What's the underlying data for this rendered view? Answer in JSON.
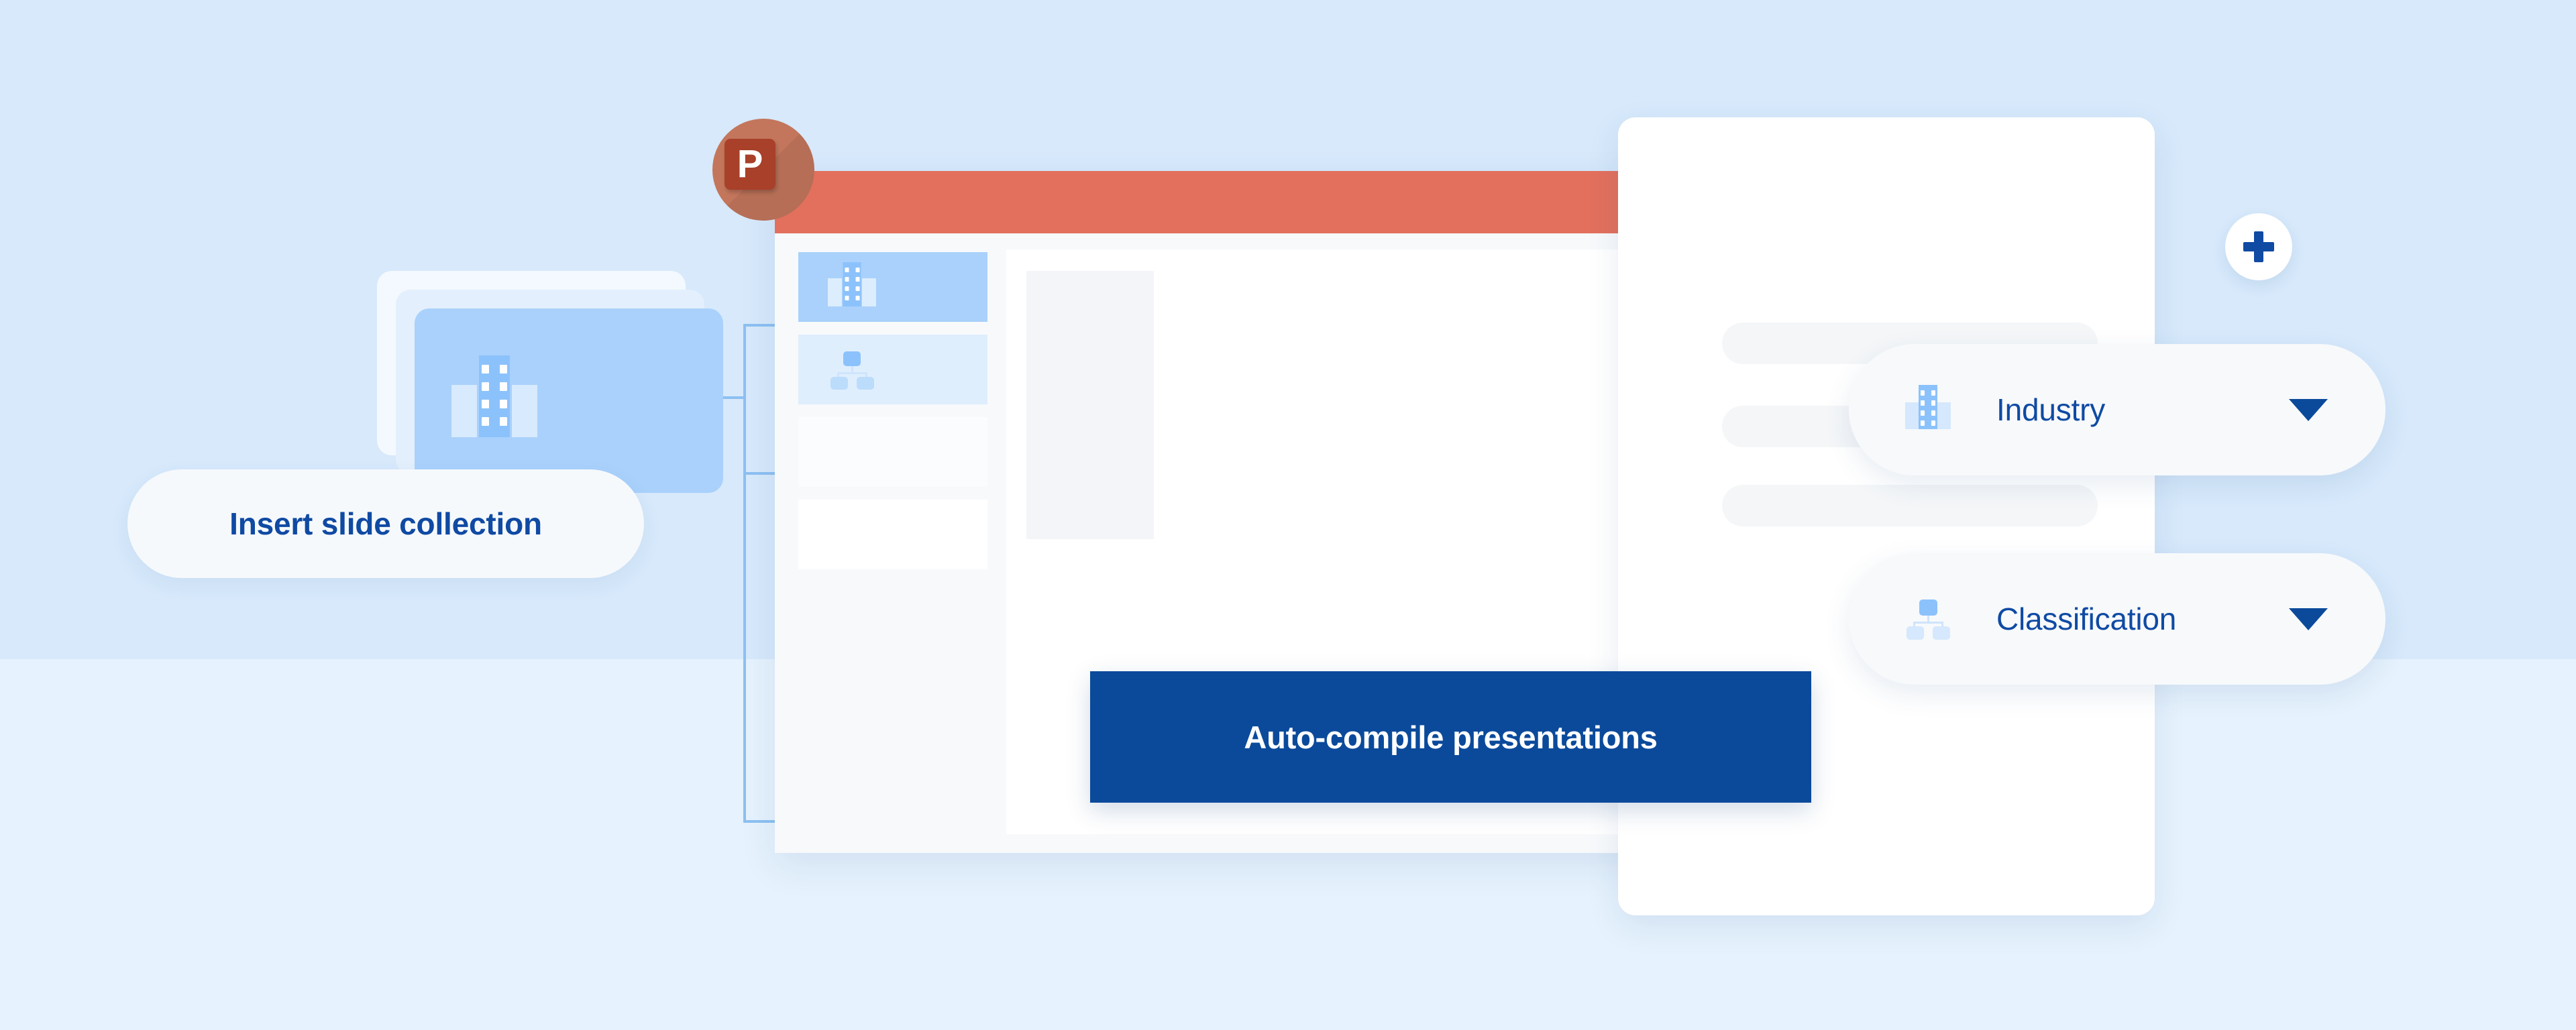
{
  "theme": {
    "bg_top": "#d7e9fb",
    "bg_bottom": "#e6f2fd",
    "accent_blue": "#0b4a9b",
    "label_blue": "#0f4aa3",
    "icon_blue": "#8cc2fb",
    "ppt_salmon": "#e2705d",
    "ppt_brand": "#a8402a",
    "panel_white": "#ffffff"
  },
  "source_stack": {
    "icon": "building-icon",
    "card_count": 3
  },
  "insert_pill": {
    "label": "Insert slide collection"
  },
  "ppt_window": {
    "app_icon": {
      "name": "powerpoint-icon",
      "letter": "P"
    },
    "titlebar_color": "#e2705d",
    "thumbnails": [
      {
        "index": 1,
        "icon": "building-icon",
        "selected": true
      },
      {
        "index": 2,
        "icon": "org-chart-icon",
        "selected": false
      },
      {
        "index": 3,
        "icon": "",
        "selected": false
      },
      {
        "index": 4,
        "icon": "",
        "selected": false
      }
    ],
    "canvas": {
      "content_block": ""
    }
  },
  "auto_compile": {
    "label": "Auto-compile presentations"
  },
  "side_panel": {
    "placeholder_rows": 3
  },
  "dropdowns": [
    {
      "id": "industry",
      "icon": "building-icon",
      "label": "Industry",
      "caret": "chevron-down-icon"
    },
    {
      "id": "classification",
      "icon": "org-chart-icon",
      "label": "Classification",
      "caret": "chevron-down-icon"
    }
  ],
  "add_button": {
    "icon": "plus-icon",
    "label": "+"
  }
}
